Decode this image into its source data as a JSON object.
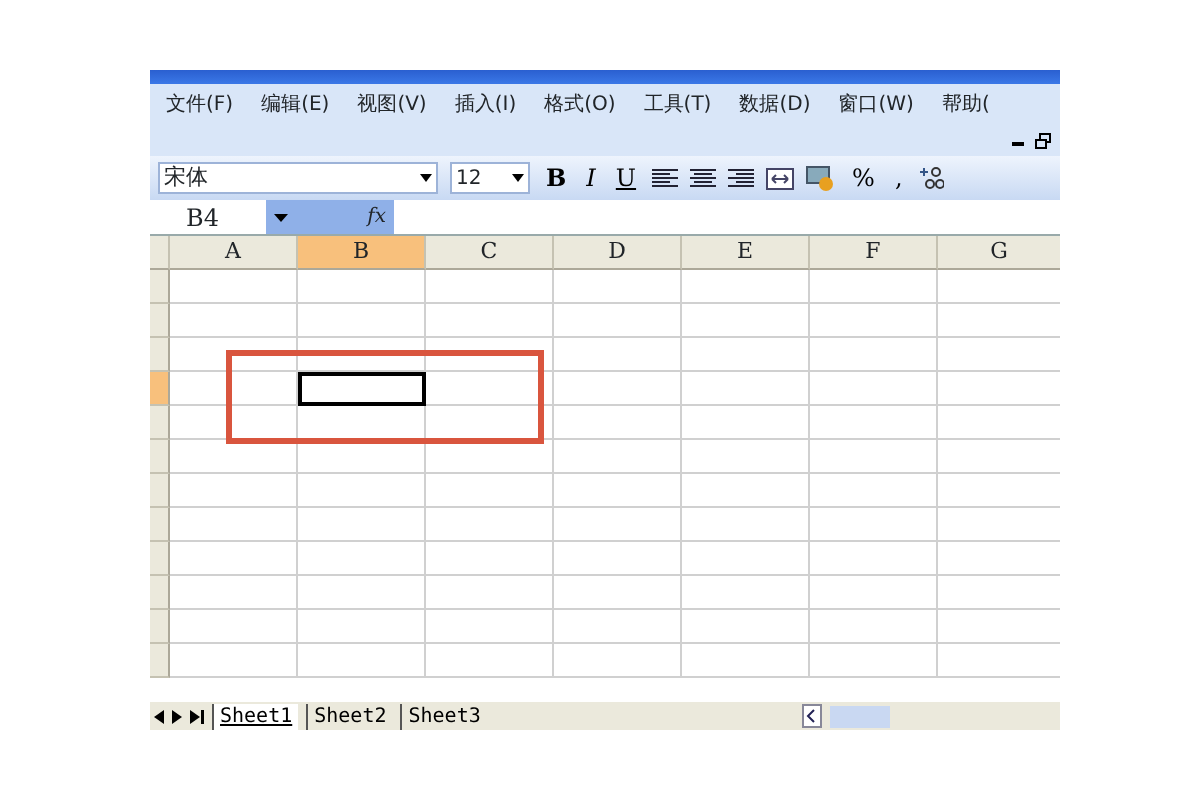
{
  "menu": [
    "文件(F)",
    "编辑(E)",
    "视图(V)",
    "插入(I)",
    "格式(O)",
    "工具(T)",
    "数据(D)",
    "窗口(W)",
    "帮助("
  ],
  "toolbar": {
    "font": "宋体",
    "size": "12",
    "styles": [
      "B",
      "I",
      "U"
    ],
    "percent": "%",
    "comma": ","
  },
  "formula_bar": {
    "name_box": "B4",
    "fx": "fx"
  },
  "columns": [
    {
      "label": "A",
      "selected": false
    },
    {
      "label": "B",
      "selected": true
    },
    {
      "label": "C",
      "selected": false
    },
    {
      "label": "D",
      "selected": false
    },
    {
      "label": "E",
      "selected": false
    },
    {
      "label": "F",
      "selected": false
    },
    {
      "label": "G",
      "selected": false
    }
  ],
  "rows": [
    {
      "selected": false
    },
    {
      "selected": false
    },
    {
      "selected": false
    },
    {
      "selected": true
    },
    {
      "selected": false
    },
    {
      "selected": false
    },
    {
      "selected": false
    },
    {
      "selected": false
    },
    {
      "selected": false
    },
    {
      "selected": false
    },
    {
      "selected": false
    },
    {
      "selected": false
    }
  ],
  "sheets": [
    {
      "label": "Sheet1",
      "selected": true
    },
    {
      "label": "Sheet2",
      "selected": false
    },
    {
      "label": "Sheet3",
      "selected": false
    }
  ]
}
